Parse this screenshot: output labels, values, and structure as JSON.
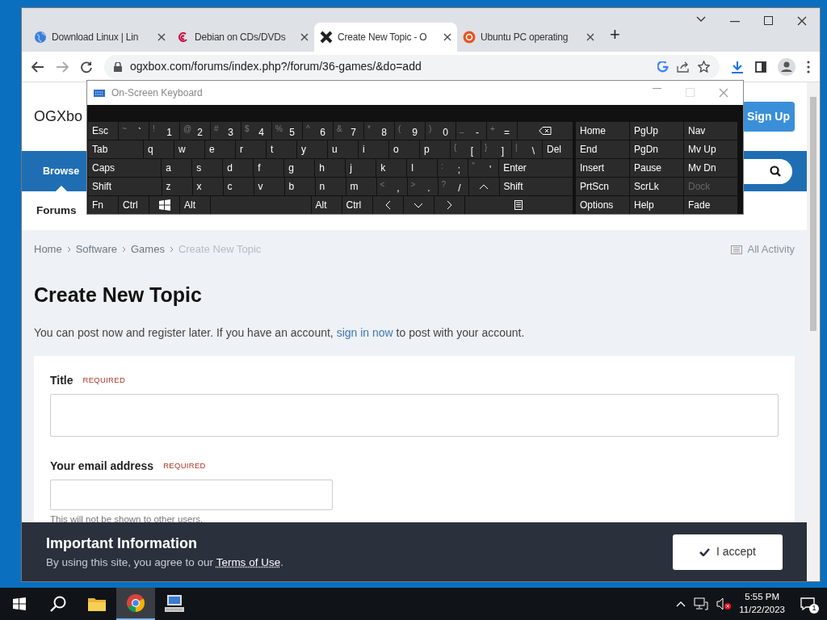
{
  "browser": {
    "tabs": [
      {
        "title": "Download Linux | Lin",
        "kind": "globe",
        "selected": false
      },
      {
        "title": "Debian on CDs/DVDs",
        "kind": "swirl",
        "selected": false
      },
      {
        "title": "Create New Topic - O",
        "kind": "cross",
        "selected": true
      },
      {
        "title": "Ubuntu PC operating",
        "kind": "ring",
        "selected": false
      }
    ],
    "new_tab": "+",
    "address": "ogxbox.com/forums/index.php?/forum/36-games/&do=add"
  },
  "site": {
    "logo": "OGXbo",
    "sign_up": "Sign Up",
    "nav": [
      {
        "label": "Browse",
        "selected": true
      }
    ],
    "subnav": [
      {
        "label": "Forums",
        "selected": true
      }
    ],
    "breadcrumb": [
      {
        "label": "Home",
        "current": false
      },
      {
        "label": "Software",
        "current": false
      },
      {
        "label": "Games",
        "current": false
      },
      {
        "label": "Create New Topic",
        "current": true
      }
    ],
    "all_activity": "All Activity",
    "heading": "Create New Topic",
    "intro": {
      "before": "You can post now and register later. If you have an account,",
      "link": "sign in now",
      "after": "to post with your account."
    },
    "fields": [
      {
        "label": "Title",
        "badge": "REQUIRED",
        "kind": "wide"
      },
      {
        "label": "Your email address",
        "badge": "REQUIRED",
        "kind": "short",
        "help": "This will not be shown to other users."
      }
    ]
  },
  "banner": {
    "title": "Important Information",
    "text_before": "By using this site, you agree to our",
    "link": "Terms of Use",
    "text_after": ".",
    "button": "I accept"
  },
  "keyboard": {
    "title": "On-Screen Keyboard",
    "rows": [
      {
        "keys": [
          {
            "label": "Esc",
            "kind": "key"
          },
          {
            "label": "`",
            "shift": "~",
            "kind": "key"
          },
          {
            "label": "1",
            "shift": "!",
            "kind": "key"
          },
          {
            "label": "2",
            "shift": "@",
            "kind": "key"
          },
          {
            "label": "3",
            "shift": "#",
            "kind": "key"
          },
          {
            "label": "4",
            "shift": "$",
            "kind": "key"
          },
          {
            "label": "5",
            "shift": "%",
            "kind": "key"
          },
          {
            "label": "6",
            "shift": "^",
            "kind": "key"
          },
          {
            "label": "7",
            "shift": "&",
            "kind": "key"
          },
          {
            "label": "8",
            "shift": "*",
            "kind": "key"
          },
          {
            "label": "9",
            "shift": "(",
            "kind": "key"
          },
          {
            "label": "0",
            "shift": ")",
            "kind": "key"
          },
          {
            "label": "-",
            "shift": "_",
            "kind": "key"
          },
          {
            "label": "=",
            "shift": "+",
            "kind": "key"
          },
          {
            "kind": "backspace"
          }
        ]
      },
      {
        "keys": [
          {
            "label": "Tab",
            "kind": "wide"
          },
          {
            "label": "q",
            "kind": "key"
          },
          {
            "label": "w",
            "kind": "key"
          },
          {
            "label": "e",
            "kind": "key"
          },
          {
            "label": "r",
            "kind": "key"
          },
          {
            "label": "t",
            "kind": "key"
          },
          {
            "label": "y",
            "kind": "key"
          },
          {
            "label": "u",
            "kind": "key"
          },
          {
            "label": "i",
            "kind": "key"
          },
          {
            "label": "o",
            "kind": "key"
          },
          {
            "label": "p",
            "kind": "key"
          },
          {
            "label": "[",
            "shift": "{",
            "kind": "key"
          },
          {
            "label": "]",
            "shift": "}",
            "kind": "key"
          },
          {
            "label": "\\",
            "shift": "|",
            "kind": "key"
          },
          {
            "label": "Del",
            "kind": "key"
          }
        ]
      },
      {
        "keys": [
          {
            "label": "Caps",
            "kind": "wide"
          },
          {
            "label": "a",
            "kind": "key"
          },
          {
            "label": "s",
            "kind": "key"
          },
          {
            "label": "d",
            "kind": "key"
          },
          {
            "label": "f",
            "kind": "key"
          },
          {
            "label": "g",
            "kind": "key"
          },
          {
            "label": "h",
            "kind": "key"
          },
          {
            "label": "j",
            "kind": "key"
          },
          {
            "label": "k",
            "kind": "key"
          },
          {
            "label": "l",
            "kind": "key"
          },
          {
            "label": ";",
            "shift": ":",
            "kind": "key"
          },
          {
            "label": "'",
            "shift": "\"",
            "kind": "key"
          },
          {
            "label": "Enter",
            "kind": "wide"
          }
        ]
      },
      {
        "keys": [
          {
            "label": "Shift",
            "kind": "wide"
          },
          {
            "label": "z",
            "kind": "key"
          },
          {
            "label": "x",
            "kind": "key"
          },
          {
            "label": "c",
            "kind": "key"
          },
          {
            "label": "v",
            "kind": "key"
          },
          {
            "label": "b",
            "kind": "key"
          },
          {
            "label": "n",
            "kind": "key"
          },
          {
            "label": "m",
            "kind": "key"
          },
          {
            "label": ",",
            "shift": "<",
            "kind": "key"
          },
          {
            "label": ".",
            "shift": ">",
            "kind": "key"
          },
          {
            "label": "/",
            "shift": "?",
            "kind": "key"
          },
          {
            "kind": "up"
          },
          {
            "label": "Shift",
            "kind": "wide"
          }
        ]
      },
      {
        "keys": [
          {
            "label": "Fn",
            "kind": "key"
          },
          {
            "label": "Ctrl",
            "kind": "key"
          },
          {
            "kind": "windows"
          },
          {
            "label": "Alt",
            "kind": "key"
          },
          {
            "kind": "space"
          },
          {
            "label": "Alt",
            "kind": "key"
          },
          {
            "label": "Ctrl",
            "kind": "key"
          },
          {
            "kind": "left"
          },
          {
            "kind": "down"
          },
          {
            "kind": "right"
          },
          {
            "kind": "menu"
          }
        ]
      }
    ],
    "side": [
      [
        {
          "label": "Home",
          "disabled": false
        },
        {
          "label": "PgUp",
          "disabled": false
        },
        {
          "label": "Nav",
          "disabled": false
        }
      ],
      [
        {
          "label": "End",
          "disabled": false
        },
        {
          "label": "PgDn",
          "disabled": false
        },
        {
          "label": "Mv Up",
          "disabled": false
        }
      ],
      [
        {
          "label": "Insert",
          "disabled": false
        },
        {
          "label": "Pause",
          "disabled": false
        },
        {
          "label": "Mv Dn",
          "disabled": false
        }
      ],
      [
        {
          "label": "PrtScn",
          "disabled": false
        },
        {
          "label": "ScrLk",
          "disabled": false
        },
        {
          "label": "Dock",
          "disabled": true
        }
      ],
      [
        {
          "label": "Options",
          "disabled": false
        },
        {
          "label": "Help",
          "disabled": false
        },
        {
          "label": "Fade",
          "disabled": false
        }
      ]
    ]
  },
  "taskbar": {
    "apps": [
      {
        "kind": "folder",
        "selected": false
      },
      {
        "kind": "chrome",
        "selected": true
      },
      {
        "kind": "keyboard",
        "selected": false
      }
    ],
    "time": "5:55 PM",
    "date": "11/22/2023",
    "notifications": "1"
  }
}
